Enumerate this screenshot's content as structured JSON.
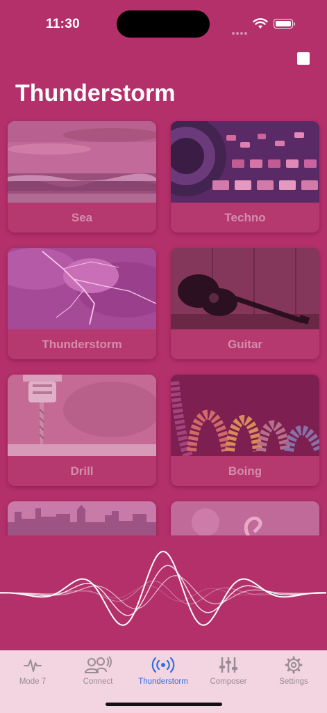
{
  "status": {
    "time": "11:30"
  },
  "page": {
    "title": "Thunderstorm"
  },
  "sounds": [
    {
      "label": "Sea"
    },
    {
      "label": "Techno"
    },
    {
      "label": "Thunderstorm"
    },
    {
      "label": "Guitar"
    },
    {
      "label": "Drill"
    },
    {
      "label": "Boing"
    }
  ],
  "tabs": [
    {
      "label": "Mode 7",
      "icon": "waveform-icon"
    },
    {
      "label": "Connect",
      "icon": "people-broadcast-icon"
    },
    {
      "label": "Thunderstorm",
      "icon": "broadcast-icon",
      "active": true
    },
    {
      "label": "Composer",
      "icon": "sliders-icon"
    },
    {
      "label": "Settings",
      "icon": "gear-icon"
    }
  ],
  "colors": {
    "background": "#b3306a",
    "tabbar": "#f3d4e1",
    "accent": "#2e6fe0",
    "inactive_tab": "#9a8c94"
  }
}
